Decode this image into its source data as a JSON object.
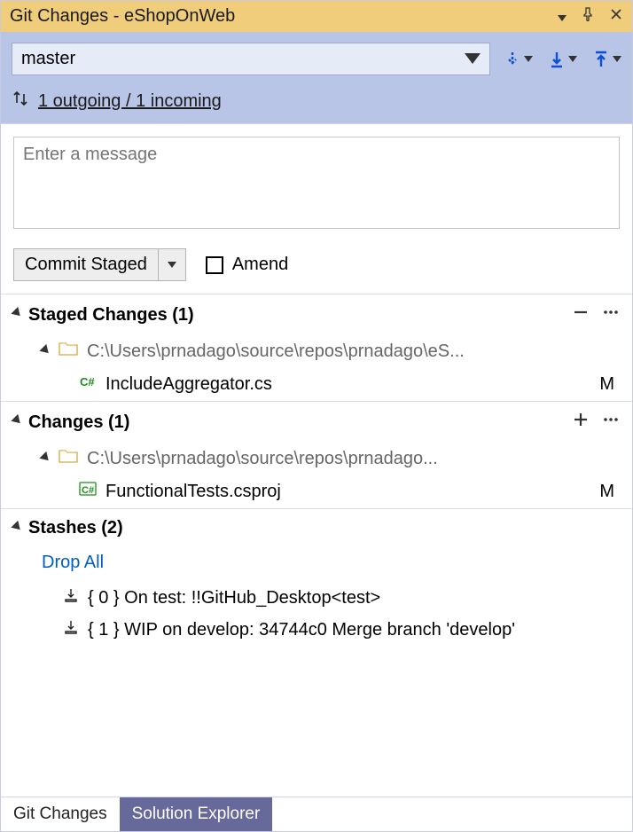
{
  "titlebar": {
    "title": "Git Changes - eShopOnWeb"
  },
  "branch": {
    "name": "master"
  },
  "sync": {
    "text": "1 outgoing / 1 incoming"
  },
  "commit": {
    "placeholder": "Enter a message",
    "button_label": "Commit Staged",
    "amend_label": "Amend"
  },
  "staged": {
    "header": "Staged Changes (1)",
    "folder": "C:\\Users\\prnadago\\source\\repos\\prnadago\\eS...",
    "file": "IncludeAggregator.cs",
    "status": "M"
  },
  "changes": {
    "header": "Changes (1)",
    "folder": "C:\\Users\\prnadago\\source\\repos\\prnadago...",
    "file": "FunctionalTests.csproj",
    "status": "M"
  },
  "stashes": {
    "header": "Stashes (2)",
    "drop_all": "Drop All",
    "items": [
      "{ 0 }  On test: !!GitHub_Desktop<test>",
      "{ 1 }  WIP on develop: 34744c0 Merge branch 'develop'"
    ]
  },
  "tabs": {
    "git_changes": "Git Changes",
    "solution_explorer": "Solution Explorer"
  }
}
